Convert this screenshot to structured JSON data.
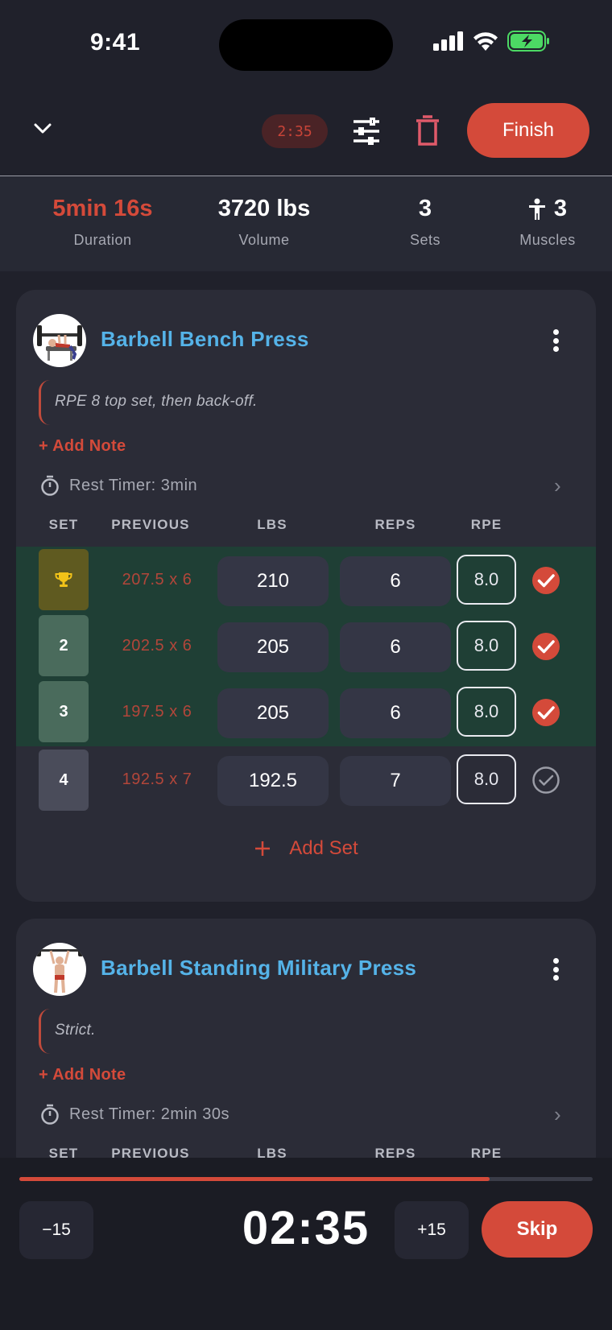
{
  "status_bar": {
    "time": "9:41"
  },
  "header": {
    "collapse_icon": "chevron-down-icon",
    "timer_pill": "2:35",
    "settings_icon": "sliders-icon",
    "delete_icon": "trash-icon",
    "finish_label": "Finish"
  },
  "stats": [
    {
      "value": "5min 16s",
      "label": "Duration"
    },
    {
      "value": "3720 lbs",
      "label": "Volume"
    },
    {
      "value": "3",
      "label": "Sets"
    },
    {
      "value": "3",
      "label": "Muscles",
      "icon": "person-icon"
    }
  ],
  "columns": {
    "set": "SET",
    "previous": "PREVIOUS",
    "lbs": "LBS",
    "reps": "REPS",
    "rpe": "RPE"
  },
  "exercises": [
    {
      "name": "Barbell Bench Press",
      "note": "RPE 8 top set, then back-off.",
      "add_note": "+ Add Note",
      "rest_timer": "Rest Timer: 3min",
      "sets": [
        {
          "set": "",
          "badge_icon": "trophy-icon",
          "previous": "207.5 x 6",
          "lbs": "210",
          "reps": "6",
          "rpe": "8.0",
          "done": true
        },
        {
          "set": "2",
          "previous": "202.5 x 6",
          "lbs": "205",
          "reps": "6",
          "rpe": "8.0",
          "done": true
        },
        {
          "set": "3",
          "previous": "197.5 x 6",
          "lbs": "205",
          "reps": "6",
          "rpe": "8.0",
          "done": true
        },
        {
          "set": "4",
          "previous": "192.5 x 7",
          "lbs": "192.5",
          "reps": "7",
          "rpe": "8.0",
          "done": false
        }
      ],
      "add_set": "Add Set"
    },
    {
      "name": "Barbell Standing Military Press",
      "note": "Strict.",
      "add_note": "+ Add Note",
      "rest_timer": "Rest Timer: 2min 30s"
    }
  ],
  "rest_bar": {
    "minus_label": "−15",
    "time": "02:35",
    "plus_label": "+15",
    "skip_label": "Skip",
    "progress": 0.82
  },
  "colors": {
    "accent": "#d44a3a",
    "link": "#55b3e8",
    "done_row": "#1f3f35",
    "background": "#20212b"
  }
}
